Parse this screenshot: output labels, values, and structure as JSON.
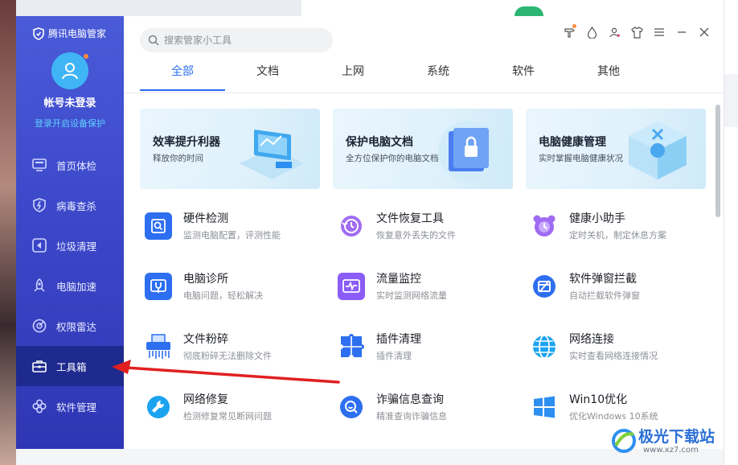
{
  "brand": {
    "title": "腾讯电脑管家"
  },
  "account": {
    "status": "帐号未登录",
    "link": "登录开启设备保护"
  },
  "nav": [
    {
      "label": "首页体检",
      "icon": "monitor-icon"
    },
    {
      "label": "病毒查杀",
      "icon": "shield-bolt-icon"
    },
    {
      "label": "垃圾清理",
      "icon": "broom-icon"
    },
    {
      "label": "电脑加速",
      "icon": "rocket-icon"
    },
    {
      "label": "权限雷达",
      "icon": "radar-icon"
    },
    {
      "label": "工具箱",
      "icon": "toolbox-icon",
      "active": true
    },
    {
      "label": "软件管理",
      "icon": "apps-icon"
    }
  ],
  "search": {
    "placeholder": "搜索管家小工具"
  },
  "tabs": [
    "全部",
    "文档",
    "上网",
    "系统",
    "软件",
    "其他"
  ],
  "active_tab": "全部",
  "banners": [
    {
      "title": "效率提升利器",
      "sub": "释放你的时间"
    },
    {
      "title": "保护电脑文档",
      "sub": "全方位保护你的电脑文档"
    },
    {
      "title": "电脑健康管理",
      "sub": "实时掌握电脑健康状况"
    }
  ],
  "tools": [
    {
      "name": "硬件检测",
      "desc": "监测电脑配置，评测性能",
      "icon": "hardware-check-icon",
      "color": "#2d6ff0"
    },
    {
      "name": "文件恢复工具",
      "desc": "恢复意外丢失的文件",
      "icon": "file-restore-icon",
      "color": "#8b5cf6"
    },
    {
      "name": "健康小助手",
      "desc": "定时关机，制定休息方案",
      "icon": "alarm-clock-icon",
      "color": "#8b5cf6"
    },
    {
      "name": "电脑诊所",
      "desc": "电脑问题，轻松解决",
      "icon": "stethoscope-icon",
      "color": "#2d6ff0"
    },
    {
      "name": "流量监控",
      "desc": "实时监测网络流量",
      "icon": "traffic-monitor-icon",
      "color": "#8b5cf6"
    },
    {
      "name": "软件弹窗拦截",
      "desc": "自动拦截软件弹窗",
      "icon": "popup-block-icon",
      "color": "#2d6ff0"
    },
    {
      "name": "文件粉碎",
      "desc": "彻底粉碎无法删除文件",
      "icon": "shredder-icon",
      "color": "#2d6ff0"
    },
    {
      "name": "插件清理",
      "desc": "插件清理",
      "icon": "puzzle-icon",
      "color": "#2d6ff0"
    },
    {
      "name": "网络连接",
      "desc": "实时查看网络连接情况",
      "icon": "globe-icon",
      "color": "#1ba3f0"
    },
    {
      "name": "网络修复",
      "desc": "检测修复常见断网问题",
      "icon": "wrench-icon",
      "color": "#1ba3f0"
    },
    {
      "name": "诈骗信息查询",
      "desc": "精准查询诈骗信息",
      "icon": "fraud-search-icon",
      "color": "#2d6ff0"
    },
    {
      "name": "Win10优化",
      "desc": "优化Windows 10系统",
      "icon": "windows-icon",
      "color": "#2d8ff0"
    }
  ],
  "watermark": {
    "text": "极光下载站",
    "url": "www.xz7.com"
  },
  "colors": {
    "accent": "#2d6ff0",
    "sidebar": "#3c48c9",
    "arrow": "#e02020"
  }
}
